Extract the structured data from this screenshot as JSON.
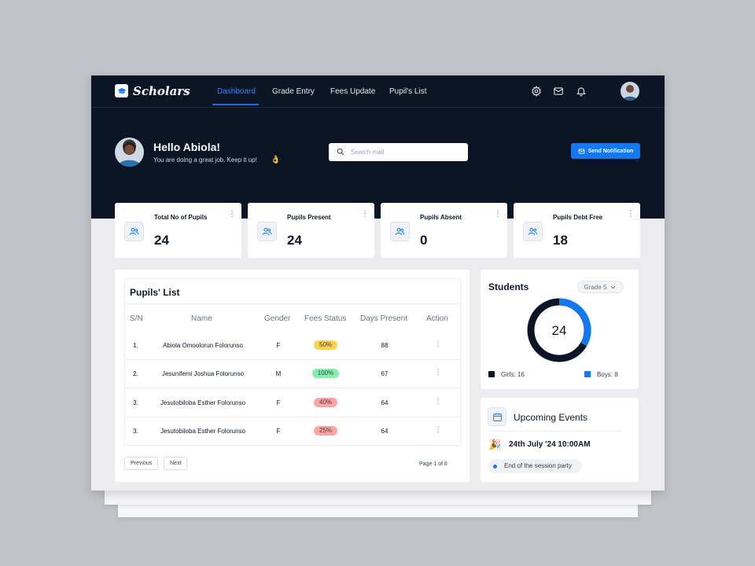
{
  "nav": {
    "brand": "Scholars",
    "items": [
      {
        "label": "Dashboard",
        "active": true
      },
      {
        "label": "Grade Entry",
        "active": false
      },
      {
        "label": "Fees Update",
        "active": false
      },
      {
        "label": "Pupil's List",
        "active": false
      }
    ],
    "icons": [
      "gear-icon",
      "mail-icon",
      "bell-icon"
    ]
  },
  "header": {
    "greeting": "Hello  Abiola!",
    "subtitle": "You are doing a great job. Keep it up!",
    "search_placeholder": "Search mail",
    "notify_label": "Send Notification"
  },
  "stats": [
    {
      "label": "Total No of Pupils",
      "value": "24"
    },
    {
      "label": "Pupils Present",
      "value": "24"
    },
    {
      "label": "Pupils Absent",
      "value": "0"
    },
    {
      "label": "Pupils Debt Free",
      "value": "18"
    }
  ],
  "pupils": {
    "title": "Pupils' List",
    "columns": [
      "S/N",
      "Name",
      "Gender",
      "Fees Status",
      "Days Present",
      "Action"
    ],
    "rows": [
      {
        "sn": "1.",
        "name": "Abiola Omoolorun Folorunso",
        "gender": "F",
        "fees": "50%",
        "fees_color": "#fcd34d",
        "days": "88"
      },
      {
        "sn": "2.",
        "name": "Jesunifemi Joshua Folorunso",
        "gender": "M",
        "fees": "100%",
        "fees_color": "#86efac",
        "days": "67"
      },
      {
        "sn": "3.",
        "name": "Jesutobiloba Esther Folorunso",
        "gender": "F",
        "fees": "40%",
        "fees_color": "#fca5a5",
        "days": "64"
      },
      {
        "sn": "3.",
        "name": "Jesutobiloba Esther Folorunso",
        "gender": "F",
        "fees": "25%",
        "fees_color": "#fca5a5",
        "days": "64"
      }
    ],
    "prev_label": "Previous",
    "next_label": "Next",
    "page_info": "Page 1 of 8"
  },
  "students": {
    "title": "Students",
    "grade": "Grade 5",
    "total": "24",
    "girls_label": "Girls: 16",
    "boys_label": "Boys: 8",
    "girls": 16,
    "boys": 8,
    "girls_color": "#0b1526",
    "boys_color": "#1478f0"
  },
  "events": {
    "title": "Upcoming Events",
    "date": "24th July '24  10:00AM",
    "description": "End of the session party"
  }
}
